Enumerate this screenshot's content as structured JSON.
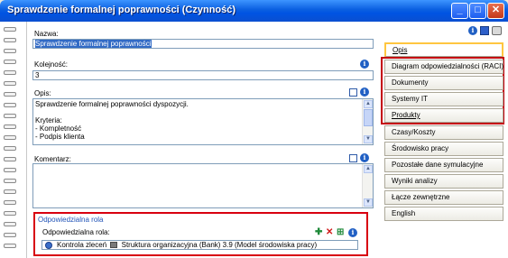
{
  "window": {
    "title": "Sprawdzenie formalnej poprawności (Czynność)",
    "minimize_glyph": "_",
    "maximize_glyph": "□",
    "close_glyph": "✕"
  },
  "form": {
    "name_label": "Nazwa:",
    "name_value": "Sprawdzenie formalnej poprawności",
    "order_label": "Kolejność:",
    "order_value": "3",
    "description_label": "Opis:",
    "description_lines": [
      "Sprawdzenie formalnej poprawności dyspozycji.",
      "",
      "Kryteria:",
      "- Kompletność",
      "- Podpis klienta"
    ],
    "comment_label": "Komentarz:",
    "comment_value": ""
  },
  "role_section": {
    "title": "Odpowiedzialna rola",
    "field_label": "Odpowiedzialna rola:",
    "role_name": "Kontrola zleceń",
    "org_text": "Struktura organizacyjna (Bank) 3.9 (Model środowiska pracy)"
  },
  "tabs": [
    {
      "label": "Opis",
      "active": true
    },
    {
      "label": "Diagram odpowiedzialności (RACI)",
      "active": false
    },
    {
      "label": "Dokumenty",
      "active": false
    },
    {
      "label": "Systemy IT",
      "active": false
    },
    {
      "label": "Produkty",
      "active": false
    },
    {
      "label": "Czasy/Koszty",
      "active": false
    },
    {
      "label": "Środowisko pracy",
      "active": false
    },
    {
      "label": "Pozostałe dane symulacyjne",
      "active": false
    },
    {
      "label": "Wyniki analizy",
      "active": false
    },
    {
      "label": "Łącze zewnętrzne",
      "active": false
    },
    {
      "label": "English",
      "active": false
    }
  ],
  "icons": {
    "info": "i",
    "add": "✚",
    "remove": "✕",
    "new": "⊞"
  },
  "colors": {
    "title_bar": "#0054e3",
    "highlight_border": "#d8000f",
    "selection": "#316ac5",
    "active_tab": "#ffc640"
  }
}
